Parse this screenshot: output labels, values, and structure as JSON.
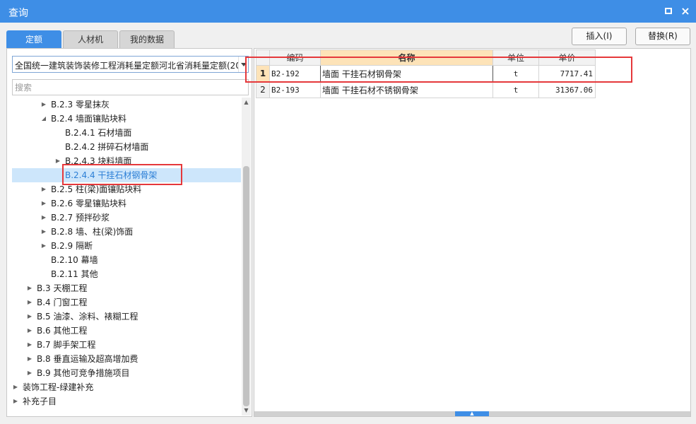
{
  "window": {
    "title": "查询"
  },
  "tabs": [
    {
      "label": "定额",
      "active": true
    },
    {
      "label": "人材机",
      "active": false
    },
    {
      "label": "我的数据",
      "active": false
    }
  ],
  "actions": {
    "insert_label": "插入(I)",
    "replace_label": "替换(R)"
  },
  "library_select": {
    "value": "全国统一建筑装饰装修工程消耗量定额河北省消耗量定额(2012)"
  },
  "search": {
    "placeholder": "搜索",
    "value": ""
  },
  "tree": [
    {
      "label": "B.2.3 零星抹灰",
      "level": 2,
      "arrow": "collapsed"
    },
    {
      "label": "B.2.4 墙面镶贴块料",
      "level": 2,
      "arrow": "expanded"
    },
    {
      "label": "B.2.4.1 石材墙面",
      "level": 3,
      "arrow": "none"
    },
    {
      "label": "B.2.4.2 拼碎石材墙面",
      "level": 3,
      "arrow": "none"
    },
    {
      "label": "B.2.4.3 块料墙面",
      "level": 3,
      "arrow": "collapsed"
    },
    {
      "label": "B.2.4.4 干挂石材钢骨架",
      "level": 3,
      "arrow": "none",
      "selected": true
    },
    {
      "label": "B.2.5 柱(梁)面镶贴块料",
      "level": 2,
      "arrow": "collapsed"
    },
    {
      "label": "B.2.6 零星镶贴块料",
      "level": 2,
      "arrow": "collapsed"
    },
    {
      "label": "B.2.7 预拌砂浆",
      "level": 2,
      "arrow": "collapsed"
    },
    {
      "label": "B.2.8 墙、柱(梁)饰面",
      "level": 2,
      "arrow": "collapsed"
    },
    {
      "label": "B.2.9 隔断",
      "level": 2,
      "arrow": "collapsed"
    },
    {
      "label": "B.2.10 幕墙",
      "level": 2,
      "arrow": "none"
    },
    {
      "label": "B.2.11 其他",
      "level": 2,
      "arrow": "none"
    },
    {
      "label": "B.3 天棚工程",
      "level": 1,
      "arrow": "collapsed"
    },
    {
      "label": "B.4 门窗工程",
      "level": 1,
      "arrow": "collapsed"
    },
    {
      "label": "B.5 油漆、涂料、裱糊工程",
      "level": 1,
      "arrow": "collapsed"
    },
    {
      "label": "B.6 其他工程",
      "level": 1,
      "arrow": "collapsed"
    },
    {
      "label": "B.7 脚手架工程",
      "level": 1,
      "arrow": "collapsed"
    },
    {
      "label": "B.8 垂直运输及超高增加费",
      "level": 1,
      "arrow": "collapsed"
    },
    {
      "label": "B.9 其他可竞争措施项目",
      "level": 1,
      "arrow": "collapsed"
    },
    {
      "label": "装饰工程-绿建补充",
      "level": 0,
      "arrow": "collapsed"
    },
    {
      "label": "补充子目",
      "level": 0,
      "arrow": "collapsed"
    }
  ],
  "grid": {
    "columns": [
      "编码",
      "名称",
      "单位",
      "单价"
    ],
    "rows": [
      {
        "no": "1",
        "code": "B2-192",
        "name": "墙面 干挂石材钢骨架",
        "unit": "t",
        "price": "7717.41",
        "current": true
      },
      {
        "no": "2",
        "code": "B2-193",
        "name": "墙面 干挂石材不锈钢骨架",
        "unit": "t",
        "price": "31367.06",
        "current": false
      }
    ]
  },
  "colors": {
    "accent": "#3e8ee6",
    "highlight_header": "#fde3b8",
    "annotation": "#e5383b",
    "selected_row": "#cde6fb"
  }
}
